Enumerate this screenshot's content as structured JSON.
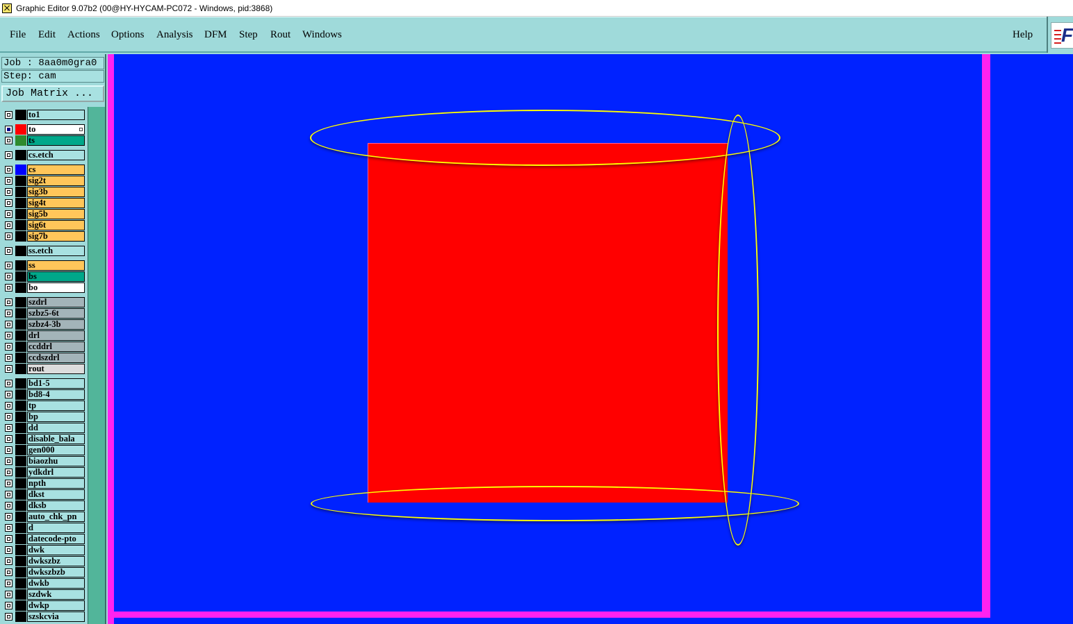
{
  "window": {
    "title": "Graphic Editor 9.07b2 (00@HY-HYCAM-PC072 - Windows, pid:3868)",
    "icon": "app-icon"
  },
  "menu": {
    "items": [
      "File",
      "Edit",
      "Actions",
      "Options",
      "Analysis",
      "DFM",
      "Step",
      "Rout",
      "Windows"
    ],
    "help": "Help"
  },
  "info": {
    "job": "Job : 8aa0m0gra0",
    "step": "Step: cam",
    "job_matrix": "Job Matrix ..."
  },
  "layers": [
    {
      "name": "to1",
      "swatch": "#000000",
      "bg": "#a8e1e1"
    },
    {
      "name": "to",
      "swatch": "#ff0000",
      "bg": "#ffffff",
      "selected": true
    },
    {
      "name": "ts",
      "swatch": "#2e8b2e",
      "bg": "#00a88a"
    },
    {
      "name": "cs.etch",
      "swatch": "#000000",
      "bg": "#a8e1e1"
    },
    {
      "name": "cs",
      "swatch": "#0000ff",
      "bg": "#ffc65a"
    },
    {
      "name": "sig2t",
      "swatch": "#000000",
      "bg": "#ffc65a"
    },
    {
      "name": "sig3b",
      "swatch": "#000000",
      "bg": "#ffc65a"
    },
    {
      "name": "sig4t",
      "swatch": "#000000",
      "bg": "#ffc65a"
    },
    {
      "name": "sig5b",
      "swatch": "#000000",
      "bg": "#ffc65a"
    },
    {
      "name": "sig6t",
      "swatch": "#000000",
      "bg": "#ffc65a"
    },
    {
      "name": "sig7b",
      "swatch": "#000000",
      "bg": "#ffc65a"
    },
    {
      "name": "ss.etch",
      "swatch": "#000000",
      "bg": "#a8e1e1"
    },
    {
      "name": "ss",
      "swatch": "#000000",
      "bg": "#ffc65a"
    },
    {
      "name": "bs",
      "swatch": "#000000",
      "bg": "#00a88a"
    },
    {
      "name": "bo",
      "swatch": "#000000",
      "bg": "#ffffff"
    },
    {
      "name": "szdrl",
      "swatch": "#000000",
      "bg": "#a3b4b9"
    },
    {
      "name": "szbz5-6t",
      "swatch": "#000000",
      "bg": "#a3b4b9"
    },
    {
      "name": "szbz4-3b",
      "swatch": "#000000",
      "bg": "#a3b4b9"
    },
    {
      "name": "drl",
      "swatch": "#000000",
      "bg": "#a3b4b9"
    },
    {
      "name": "ccddrl",
      "swatch": "#000000",
      "bg": "#a3b4b9"
    },
    {
      "name": "ccdszdrl",
      "swatch": "#000000",
      "bg": "#a3b4b9"
    },
    {
      "name": "rout",
      "swatch": "#000000",
      "bg": "#dcdcdc"
    },
    {
      "name": "bd1-5",
      "swatch": "#000000",
      "bg": "#a8e1e1"
    },
    {
      "name": "bd8-4",
      "swatch": "#000000",
      "bg": "#a8e1e1"
    },
    {
      "name": "tp",
      "swatch": "#000000",
      "bg": "#a8e1e1"
    },
    {
      "name": "bp",
      "swatch": "#000000",
      "bg": "#a8e1e1"
    },
    {
      "name": "dd",
      "swatch": "#000000",
      "bg": "#a8e1e1"
    },
    {
      "name": "disable_bala",
      "swatch": "#000000",
      "bg": "#a8e1e1"
    },
    {
      "name": "gen000",
      "swatch": "#000000",
      "bg": "#a8e1e1"
    },
    {
      "name": "biaozhu",
      "swatch": "#000000",
      "bg": "#a8e1e1"
    },
    {
      "name": "ydkdrl",
      "swatch": "#000000",
      "bg": "#a8e1e1"
    },
    {
      "name": "npth",
      "swatch": "#000000",
      "bg": "#a8e1e1"
    },
    {
      "name": "dkst",
      "swatch": "#000000",
      "bg": "#a8e1e1"
    },
    {
      "name": "dksb",
      "swatch": "#000000",
      "bg": "#a8e1e1"
    },
    {
      "name": "auto_chk_pn",
      "swatch": "#000000",
      "bg": "#a8e1e1"
    },
    {
      "name": "d",
      "swatch": "#000000",
      "bg": "#a8e1e1"
    },
    {
      "name": "datecode-pto",
      "swatch": "#000000",
      "bg": "#a8e1e1"
    },
    {
      "name": "dwk",
      "swatch": "#000000",
      "bg": "#a8e1e1"
    },
    {
      "name": "dwkszbz",
      "swatch": "#000000",
      "bg": "#a8e1e1"
    },
    {
      "name": "dwkszbzb",
      "swatch": "#000000",
      "bg": "#a8e1e1"
    },
    {
      "name": "dwkb",
      "swatch": "#000000",
      "bg": "#a8e1e1"
    },
    {
      "name": "szdwk",
      "swatch": "#000000",
      "bg": "#a8e1e1"
    },
    {
      "name": "dwkp",
      "swatch": "#000000",
      "bg": "#a8e1e1"
    },
    {
      "name": "szskcvia",
      "swatch": "#000000",
      "bg": "#a8e1e1"
    }
  ],
  "colors": {
    "canvas_bg": "#0022ff",
    "profile": "#ff22f0",
    "feature": "#ff0000",
    "highlight": "#ffff00"
  }
}
